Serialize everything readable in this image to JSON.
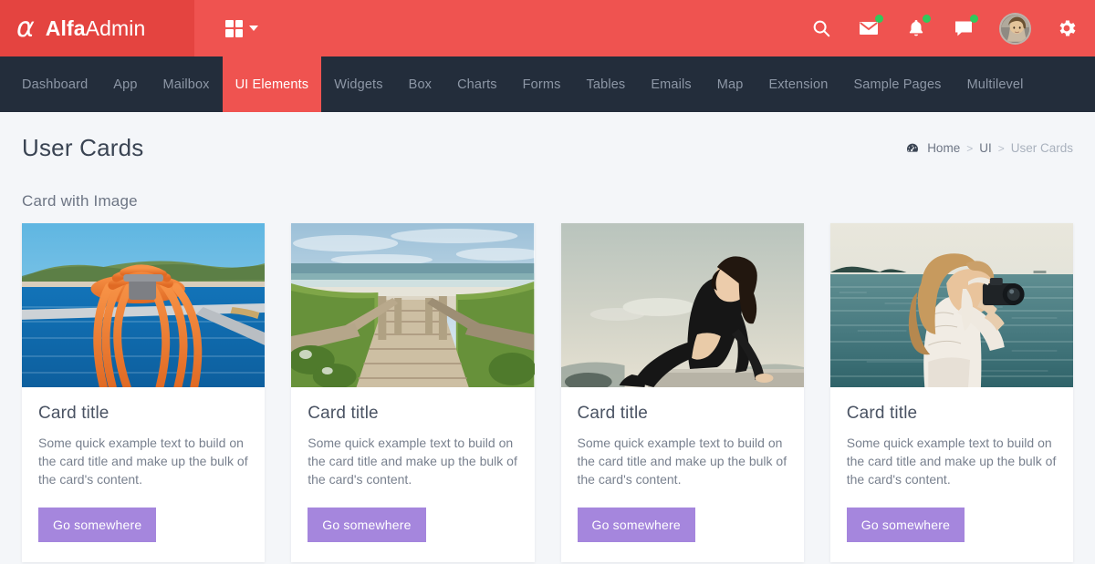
{
  "header": {
    "logo_symbol": "α",
    "logo_bold": "Alfa",
    "logo_light": "Admin",
    "grid_toggle_name": "grid-apps-toggle",
    "actions": [
      {
        "name": "search-icon",
        "label": "Search",
        "badge": false
      },
      {
        "name": "mail-icon",
        "label": "Messages",
        "badge": true
      },
      {
        "name": "bell-icon",
        "label": "Notifications",
        "badge": true
      },
      {
        "name": "chat-icon",
        "label": "Chat",
        "badge": true
      }
    ],
    "avatar_label": "User profile",
    "settings_label": "Settings",
    "bg_color": "#ef5350",
    "logo_bg_color": "#e44440",
    "badge_color": "#31c85c"
  },
  "nav": {
    "bg_color": "#232d3b",
    "active_color": "#ef5350",
    "items": [
      {
        "label": "Dashboard",
        "active": false
      },
      {
        "label": "App",
        "active": false
      },
      {
        "label": "Mailbox",
        "active": false
      },
      {
        "label": "UI Elements",
        "active": true
      },
      {
        "label": "Widgets",
        "active": false
      },
      {
        "label": "Box",
        "active": false
      },
      {
        "label": "Charts",
        "active": false
      },
      {
        "label": "Forms",
        "active": false
      },
      {
        "label": "Tables",
        "active": false
      },
      {
        "label": "Emails",
        "active": false
      },
      {
        "label": "Map",
        "active": false
      },
      {
        "label": "Extension",
        "active": false
      },
      {
        "label": "Sample Pages",
        "active": false
      },
      {
        "label": "Multilevel",
        "active": false
      }
    ]
  },
  "page": {
    "title": "User Cards",
    "section_title": "Card with Image",
    "breadcrumb": {
      "icon": "dashboard-speedometer-icon",
      "items": [
        "Home",
        "UI",
        "User Cards"
      ],
      "separator": ">"
    }
  },
  "cards": [
    {
      "title": "Card title",
      "text": "Some quick example text to build on the card title and make up the bulk of the card's content.",
      "button_label": "Go somewhere",
      "image_name": "orange-rope-on-boat-railing-photo"
    },
    {
      "title": "Card title",
      "text": "Some quick example text to build on the card title and make up the bulk of the card's content.",
      "button_label": "Go somewhere",
      "image_name": "wooden-boardwalk-to-beach-photo"
    },
    {
      "title": "Card title",
      "text": "Some quick example text to build on the card title and make up the bulk of the card's content.",
      "button_label": "Go somewhere",
      "image_name": "woman-in-black-sitting-on-ledge-photo"
    },
    {
      "title": "Card title",
      "text": "Some quick example text to build on the card title and make up the bulk of the card's content.",
      "button_label": "Go somewhere",
      "image_name": "woman-photographing-the-sea-photo"
    }
  ],
  "theme": {
    "page_bg": "#f4f6f9",
    "card_bg": "#ffffff",
    "button_color": "#a586dd",
    "title_color": "#3a4453"
  }
}
